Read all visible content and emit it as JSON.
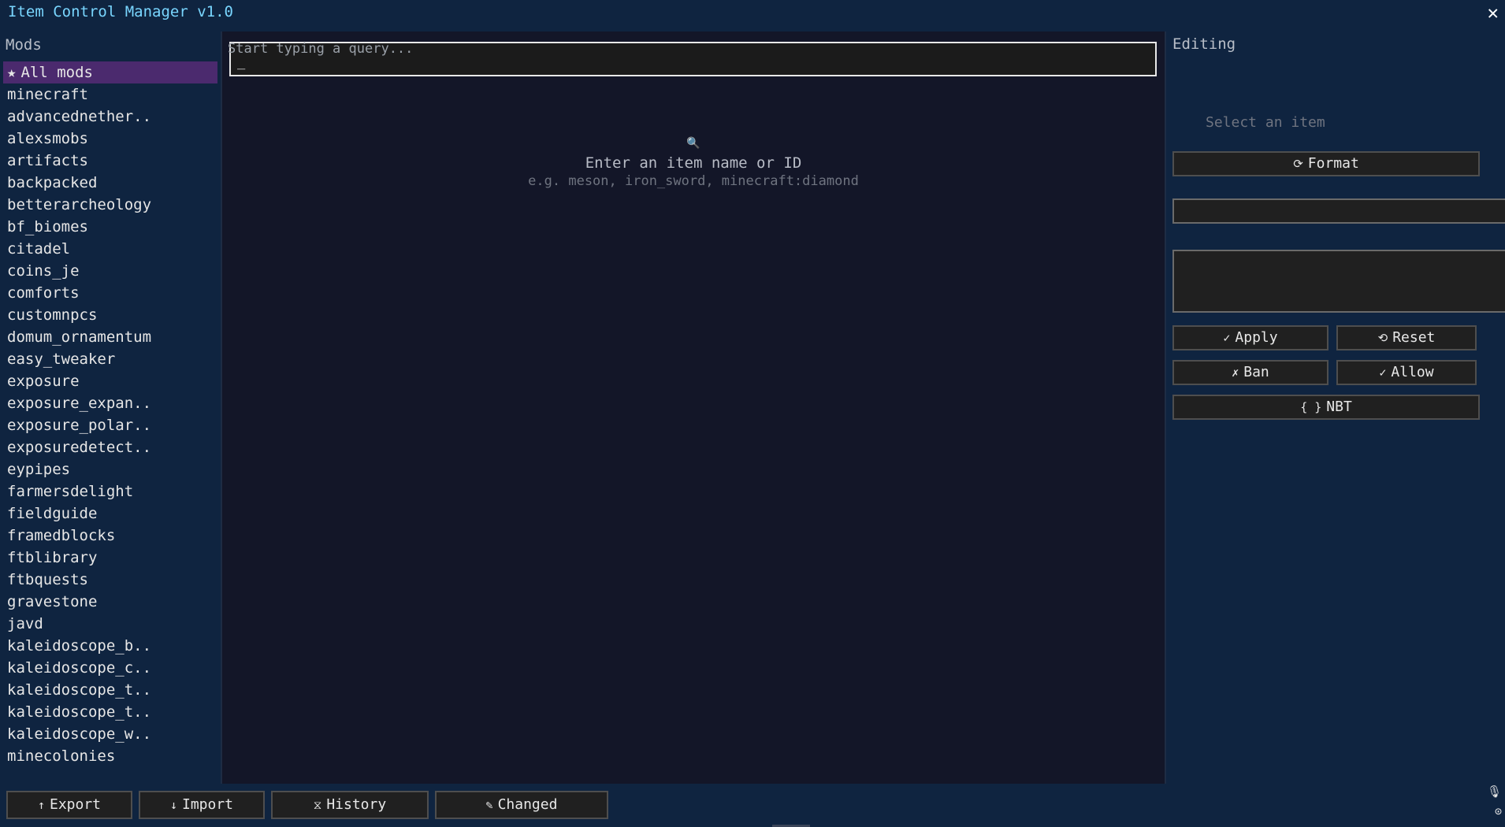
{
  "app": {
    "title": "Item Control Manager v1.0",
    "close_label": "✕"
  },
  "sidebar": {
    "title": "Mods",
    "selected": {
      "icon": "star-icon",
      "glyph": "★",
      "label": "All mods"
    },
    "mods": [
      "minecraft",
      "advancednether..",
      "alexsmobs",
      "artifacts",
      "backpacked",
      "betterarcheology",
      "bf_biomes",
      "citadel",
      "coins_je",
      "comforts",
      "customnpcs",
      "domum_ornamentum",
      "easy_tweaker",
      "exposure",
      "exposure_expan..",
      "exposure_polar..",
      "exposuredetect..",
      "eypipes",
      "farmersdelight",
      "fieldguide",
      "framedblocks",
      "ftblibrary",
      "ftbquests",
      "gravestone",
      "javd",
      "kaleidoscope_b..",
      "kaleidoscope_c..",
      "kaleidoscope_t..",
      "kaleidoscope_t..",
      "kaleidoscope_w..",
      "minecolonies"
    ]
  },
  "search": {
    "placeholder": "Start typing a query...",
    "value": "",
    "cursor": "_"
  },
  "empty_state": {
    "icon": "search-icon",
    "glyph": "🔍",
    "title": "Enter an item name or ID",
    "hint": "e.g. meson, iron_sword, minecraft:diamond"
  },
  "editor": {
    "title": "Editing",
    "empty_label": "Select an item",
    "format": {
      "glyph": "⟳",
      "label": "Format"
    },
    "apply": {
      "glyph": "✓",
      "label": "Apply"
    },
    "reset": {
      "glyph": "⟲",
      "label": "Reset"
    },
    "ban": {
      "glyph": "✗",
      "label": "Ban"
    },
    "allow": {
      "glyph": "✓",
      "label": "Allow"
    },
    "nbt": {
      "glyph": "{ }",
      "label": "NBT"
    }
  },
  "bottom": {
    "export": {
      "glyph": "↑",
      "label": "Export"
    },
    "import": {
      "glyph": "↓",
      "label": "Import"
    },
    "history": {
      "glyph": "⧖",
      "label": "History"
    },
    "changed": {
      "glyph": "✎",
      "label": "Changed"
    },
    "mic_glyph": "🎙",
    "settings_glyph": "⊙"
  },
  "colors": {
    "panel": "#0f2440",
    "content": "#131628",
    "selected": "#4b2a6e",
    "title_accent": "#79d6ff",
    "button_bg": "#202020"
  }
}
